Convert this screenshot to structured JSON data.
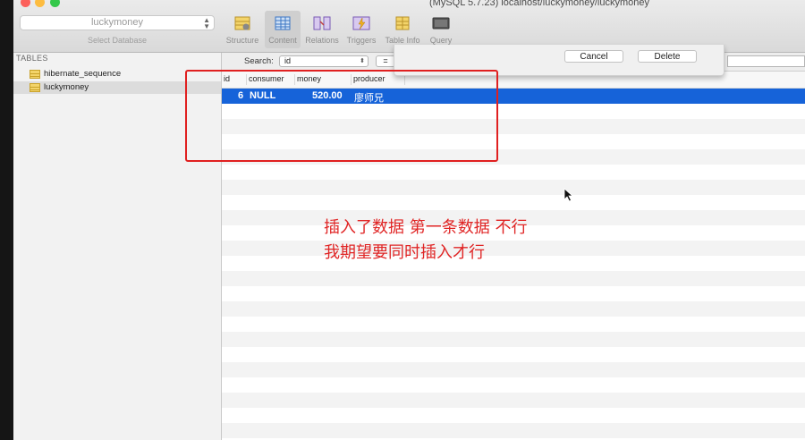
{
  "window": {
    "title": "(MySQL 5.7.23) localhost/luckymoney/luckymoney"
  },
  "toolbar": {
    "database_value": "luckymoney",
    "database_caption": "Select Database",
    "buttons": [
      {
        "label": "Structure"
      },
      {
        "label": "Content"
      },
      {
        "label": "Relations"
      },
      {
        "label": "Triggers"
      },
      {
        "label": "Table Info"
      },
      {
        "label": "Query"
      }
    ]
  },
  "sidebar": {
    "header": "TABLES",
    "tables": [
      {
        "name": "hibernate_sequence"
      },
      {
        "name": "luckymoney"
      }
    ]
  },
  "filter": {
    "search_label": "Search:",
    "field": "id",
    "operator": "="
  },
  "table": {
    "columns": [
      "id",
      "consumer",
      "money",
      "producer"
    ],
    "rows": [
      {
        "id": "6",
        "consumer": "NULL",
        "money": "520.00",
        "producer": "廖师兄"
      }
    ]
  },
  "dialog": {
    "cancel_label": "Cancel",
    "delete_label": "Delete"
  },
  "annotation": {
    "line1": "插入了数据  第一条数据  不行",
    "line2": "我期望要同时插入才行",
    "color": "#e02525"
  },
  "colors": {
    "selection": "#1663d9",
    "highlight_box": "#e02020"
  }
}
